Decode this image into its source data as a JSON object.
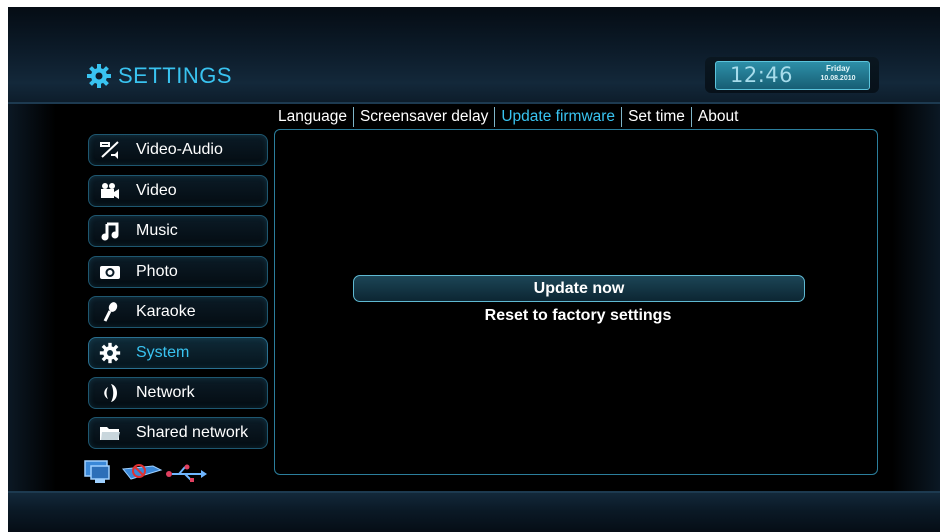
{
  "header": {
    "title": "SETTINGS",
    "title_icon": "gear-icon",
    "clock": {
      "time": "12:46",
      "day": "Friday",
      "date": "10.08.2010"
    }
  },
  "tabs": [
    {
      "label": "Language",
      "active": false
    },
    {
      "label": "Screensaver delay",
      "active": false
    },
    {
      "label": "Update firmware",
      "active": true
    },
    {
      "label": "Set time",
      "active": false
    },
    {
      "label": "About",
      "active": false
    }
  ],
  "sidebar": {
    "items": [
      {
        "label": "Video-Audio",
        "icon": "video-audio-icon",
        "selected": false
      },
      {
        "label": "Video",
        "icon": "video-camera-icon",
        "selected": false
      },
      {
        "label": "Music",
        "icon": "music-note-icon",
        "selected": false
      },
      {
        "label": "Photo",
        "icon": "photo-camera-icon",
        "selected": false
      },
      {
        "label": "Karaoke",
        "icon": "microphone-icon",
        "selected": false
      },
      {
        "label": "System",
        "icon": "gear-icon",
        "selected": true
      },
      {
        "label": "Network",
        "icon": "network-icon",
        "selected": false
      },
      {
        "label": "Shared network",
        "icon": "folder-icon",
        "selected": false
      }
    ]
  },
  "content": {
    "primary_action": "Update now",
    "secondary_action": "Reset to factory settings"
  },
  "status_icons": [
    "monitor-icon",
    "sd-card-icon",
    "usb-icon"
  ],
  "colors": {
    "accent": "#39c3f0",
    "panel_border": "#2b7e9c",
    "background": "#000000"
  }
}
